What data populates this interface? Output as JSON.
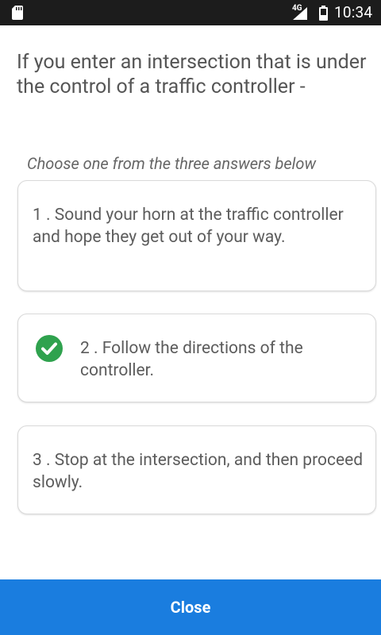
{
  "status_bar": {
    "network": "4G",
    "time": "10:34"
  },
  "question": "If you enter an intersection that is under the control of a traffic controller -",
  "instruction": "Choose one from the three answers below",
  "answers": [
    {
      "text": "1 . Sound your horn at the traffic controller and hope they get out of your way.",
      "correct": false
    },
    {
      "text": "2 . Follow the directions of the controller.",
      "correct": true,
      "icon": "check-circle-icon"
    },
    {
      "text": "3 . Stop at the intersection, and then proceed slowly.",
      "correct": false
    }
  ],
  "close_button": {
    "label": "Close"
  },
  "colors": {
    "status_bar_bg": "#1c1c1c",
    "accent_blue": "#1a7ddf",
    "correct_green": "#2fa24e",
    "text": "#5a5a5a"
  }
}
